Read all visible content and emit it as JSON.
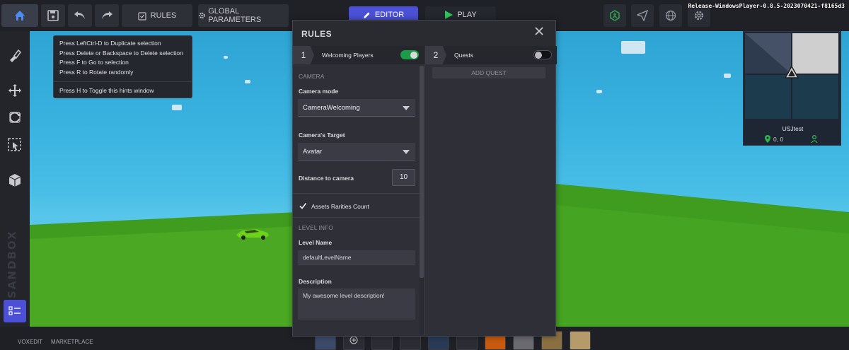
{
  "toolbar": {
    "rules_label": "RULES",
    "global_params_label": "GLOBAL PARAMETERS",
    "editor_label": "EDITOR",
    "play_label": "PLAY",
    "version": "Release-WindowsPlayer-0.8.5-2023070421-f8165d3"
  },
  "hints": {
    "lines": [
      "Press LeftCtrl-D to Duplicate selection",
      "Press Delete or Backspace to Delete selection",
      "Press F to Go to selection",
      "Press R to Rotate randomly"
    ],
    "toggle_hint": "Press H to Toggle this hints window"
  },
  "rules_modal": {
    "title": "RULES",
    "tabs": [
      {
        "number": "1",
        "label": "Welcoming Players",
        "enabled": true
      },
      {
        "number": "2",
        "label": "Quests",
        "enabled": false
      }
    ],
    "camera": {
      "section": "CAMERA",
      "mode_label": "Camera mode",
      "mode_value": "CameraWelcoming",
      "target_label": "Camera's Target",
      "target_value": "Avatar",
      "distance_label": "Distance to camera",
      "distance_value": "10"
    },
    "assets_rarities_label": "Assets Rarities Count",
    "assets_rarities_checked": true,
    "level_info": {
      "section": "LEVEL INFO",
      "name_label": "Level Name",
      "name_value": "defaultLevelName",
      "description_label": "Description",
      "description_value": "My awesome level description!"
    },
    "add_quest_label": "ADD QUEST"
  },
  "minimap": {
    "name": "USJtest",
    "coords": "0, 0"
  },
  "bottombar": {
    "voxedit": "VOXEDIT",
    "marketplace": "MARKETPLACE"
  },
  "colors": {
    "accent": "#4b50d6",
    "toggle_on": "#1c9c4b",
    "ground": "#3c9a1e",
    "sky": "#39b2e0"
  }
}
